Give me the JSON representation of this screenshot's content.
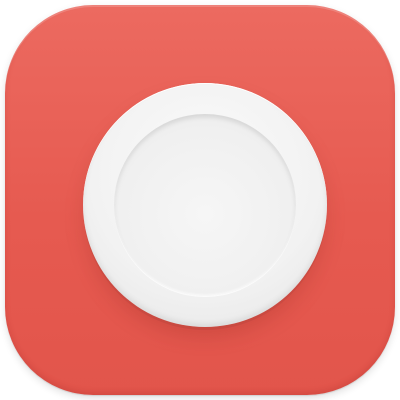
{
  "app_icon": {
    "icon_name": "plate-icon",
    "colors": {
      "background": "#e65a50",
      "plate": "#f2f2f2"
    }
  }
}
